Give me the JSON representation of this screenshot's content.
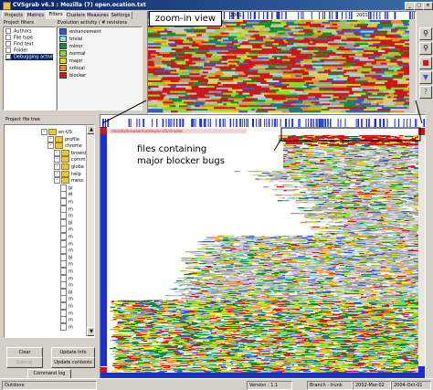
{
  "window": {
    "title": "CVSgrab v6.3 : Mozilla (7) open.ocation.txt",
    "minimize": "_",
    "maximize": "□",
    "close": "×"
  },
  "tabs": [
    "Projects",
    "Metrics",
    "Filters",
    "Clusters",
    "Measures",
    "Settings"
  ],
  "filters_panel": {
    "header": "Project filters",
    "items": [
      {
        "label": "Authors",
        "selected": false
      },
      {
        "label": "File type",
        "selected": false
      },
      {
        "label": "Find text",
        "selected": false
      },
      {
        "label": "Folder",
        "selected": false
      },
      {
        "label": "Debugging activity",
        "selected": true
      }
    ]
  },
  "evolution_panel": {
    "header": "Evolution activity / # revisions",
    "legend": [
      {
        "label": "enhancement",
        "color": "#3a58c8"
      },
      {
        "label": "trivial",
        "color": "#7fe0e6"
      },
      {
        "label": "minor",
        "color": "#1a8a3a"
      },
      {
        "label": "normal",
        "color": "#8fd62a"
      },
      {
        "label": "major",
        "color": "#e6d21a"
      },
      {
        "label": "critical",
        "color": "#f08a1a"
      },
      {
        "label": "blocker",
        "color": "#c81818"
      }
    ]
  },
  "callouts": {
    "zoom": "zoom-in view",
    "files_line1": "files containing",
    "files_line2": "major blocker bugs"
  },
  "zoom_axis": {
    "label_left": "2001",
    "label_right": "2001"
  },
  "file_tree": {
    "header": "Project file tree",
    "rows": [
      {
        "label": "en-US",
        "type": "folder",
        "level": 0
      },
      {
        "label": "profile",
        "type": "folder",
        "level": 1
      },
      {
        "label": "chrome",
        "type": "folder",
        "level": 1
      },
      {
        "label": "browsi",
        "type": "folder",
        "level": 2
      },
      {
        "label": "comm",
        "type": "folder",
        "level": 2
      },
      {
        "label": "globa",
        "type": "folder",
        "level": 2
      },
      {
        "label": "help",
        "type": "folder",
        "level": 2
      },
      {
        "label": "mess",
        "type": "folder",
        "level": 2
      },
      {
        "label": "bl",
        "type": "file",
        "level": 3
      },
      {
        "label": "M",
        "type": "file",
        "level": 3
      },
      {
        "label": "m",
        "type": "file",
        "level": 3
      },
      {
        "label": "m",
        "type": "file",
        "level": 3
      },
      {
        "label": "m",
        "type": "file",
        "level": 3
      },
      {
        "label": "bl",
        "type": "file",
        "level": 3
      },
      {
        "label": "m",
        "type": "file",
        "level": 3
      },
      {
        "label": "m",
        "type": "file",
        "level": 3
      },
      {
        "label": "m",
        "type": "file",
        "level": 3
      },
      {
        "label": "m",
        "type": "file",
        "level": 3
      },
      {
        "label": "bl",
        "type": "file",
        "level": 3
      },
      {
        "label": "m",
        "type": "file",
        "level": 3
      },
      {
        "label": "m",
        "type": "file",
        "level": 3
      },
      {
        "label": "m",
        "type": "file",
        "level": 3
      },
      {
        "label": "m",
        "type": "file",
        "level": 3
      },
      {
        "label": "bl",
        "type": "file",
        "level": 3
      },
      {
        "label": "m",
        "type": "file",
        "level": 3
      },
      {
        "label": "m",
        "type": "file",
        "level": 3
      },
      {
        "label": "m",
        "type": "file",
        "level": 3
      },
      {
        "label": "m",
        "type": "file",
        "level": 3
      },
      {
        "label": "m",
        "type": "file",
        "level": 3
      }
    ]
  },
  "buttons": {
    "clear": "Clear",
    "cancel": "Cancel",
    "update_info": "Update info",
    "update_contents": "Update contents",
    "command_log": "Command log"
  },
  "file_label": "/mozilla/browser/locales/en-US/chrome",
  "statusbar": {
    "left": "Outdone",
    "version": "Version : 1.1",
    "branch": "Branch : trunk",
    "date1": "2002-Mar-02",
    "date2": "2004-Oct-01"
  },
  "toolbar_icons": [
    "search-icon",
    "zoom-icon",
    "select-icon",
    "filter-icon",
    "help-icon"
  ]
}
